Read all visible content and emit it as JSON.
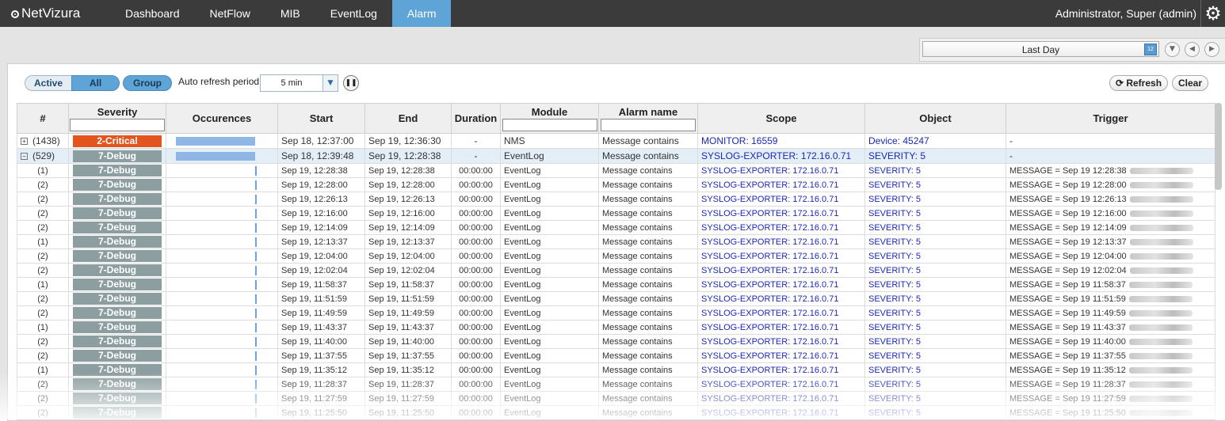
{
  "app": {
    "logo": "NetVizura",
    "user": "Administrator, Super (admin)"
  },
  "nav": [
    {
      "label": "Dashboard"
    },
    {
      "label": "NetFlow"
    },
    {
      "label": "MIB"
    },
    {
      "label": "EventLog"
    },
    {
      "label": "Alarm",
      "active": true
    }
  ],
  "period": {
    "value": "Last Day"
  },
  "toolbar": {
    "active_label": "Active",
    "all_label": "All",
    "group_label": "Group",
    "auto_refresh_label": "Auto refresh period:",
    "auto_refresh_value": "5 min",
    "refresh_label": "Refresh",
    "clear_label": "Clear"
  },
  "columns": [
    "#",
    "Severity",
    "Occurences",
    "Start",
    "End",
    "Duration",
    "Module",
    "Alarm name",
    "Scope",
    "Object",
    "Trigger"
  ],
  "groups": [
    {
      "count": "(1438)",
      "severity": "2-Critical",
      "severity_color": "#e2551f",
      "start": "Sep 18, 12:37:00",
      "end": "Sep 19, 12:36:30",
      "duration": "-",
      "module": "NMS",
      "alarm": "Message contains",
      "scope": "MONITOR: 16559",
      "object": "Device: 45247",
      "trigger": "-"
    },
    {
      "count": "(529)",
      "severity": "7-Debug",
      "severity_color": "#8d9ea0",
      "start": "Sep 18, 12:39:48",
      "end": "Sep 19, 12:28:38",
      "duration": "-",
      "module": "EventLog",
      "alarm": "Message contains",
      "scope": "SYSLOG-EXPORTER: 172.16.0.71",
      "object": "SEVERITY: 5",
      "trigger": "-"
    }
  ],
  "rows": [
    {
      "count": "(1)",
      "severity": "7-Debug",
      "start": "Sep 19, 12:28:38",
      "end": "Sep 19, 12:28:38",
      "duration": "00:00:00",
      "module": "EventLog",
      "alarm": "Message contains",
      "scope": "SYSLOG-EXPORTER: 172.16.0.71",
      "object": "SEVERITY: 5",
      "trigger": "MESSAGE = Sep 19 12:28:38"
    },
    {
      "count": "(2)",
      "severity": "7-Debug",
      "start": "Sep 19, 12:28:00",
      "end": "Sep 19, 12:28:00",
      "duration": "00:00:00",
      "module": "EventLog",
      "alarm": "Message contains",
      "scope": "SYSLOG-EXPORTER: 172.16.0.71",
      "object": "SEVERITY: 5",
      "trigger": "MESSAGE = Sep 19 12:28:00"
    },
    {
      "count": "(2)",
      "severity": "7-Debug",
      "start": "Sep 19, 12:26:13",
      "end": "Sep 19, 12:26:13",
      "duration": "00:00:00",
      "module": "EventLog",
      "alarm": "Message contains",
      "scope": "SYSLOG-EXPORTER: 172.16.0.71",
      "object": "SEVERITY: 5",
      "trigger": "MESSAGE = Sep 19 12:26:13"
    },
    {
      "count": "(2)",
      "severity": "7-Debug",
      "start": "Sep 19, 12:16:00",
      "end": "Sep 19, 12:16:00",
      "duration": "00:00:00",
      "module": "EventLog",
      "alarm": "Message contains",
      "scope": "SYSLOG-EXPORTER: 172.16.0.71",
      "object": "SEVERITY: 5",
      "trigger": "MESSAGE = Sep 19 12:16:00"
    },
    {
      "count": "(2)",
      "severity": "7-Debug",
      "start": "Sep 19, 12:14:09",
      "end": "Sep 19, 12:14:09",
      "duration": "00:00:00",
      "module": "EventLog",
      "alarm": "Message contains",
      "scope": "SYSLOG-EXPORTER: 172.16.0.71",
      "object": "SEVERITY: 5",
      "trigger": "MESSAGE = Sep 19 12:14:09"
    },
    {
      "count": "(1)",
      "severity": "7-Debug",
      "start": "Sep 19, 12:13:37",
      "end": "Sep 19, 12:13:37",
      "duration": "00:00:00",
      "module": "EventLog",
      "alarm": "Message contains",
      "scope": "SYSLOG-EXPORTER: 172.16.0.71",
      "object": "SEVERITY: 5",
      "trigger": "MESSAGE = Sep 19 12:13:37"
    },
    {
      "count": "(2)",
      "severity": "7-Debug",
      "start": "Sep 19, 12:04:00",
      "end": "Sep 19, 12:04:00",
      "duration": "00:00:00",
      "module": "EventLog",
      "alarm": "Message contains",
      "scope": "SYSLOG-EXPORTER: 172.16.0.71",
      "object": "SEVERITY: 5",
      "trigger": "MESSAGE = Sep 19 12:04:00"
    },
    {
      "count": "(2)",
      "severity": "7-Debug",
      "start": "Sep 19, 12:02:04",
      "end": "Sep 19, 12:02:04",
      "duration": "00:00:00",
      "module": "EventLog",
      "alarm": "Message contains",
      "scope": "SYSLOG-EXPORTER: 172.16.0.71",
      "object": "SEVERITY: 5",
      "trigger": "MESSAGE = Sep 19 12:02:04"
    },
    {
      "count": "(1)",
      "severity": "7-Debug",
      "start": "Sep 19, 11:58:37",
      "end": "Sep 19, 11:58:37",
      "duration": "00:00:00",
      "module": "EventLog",
      "alarm": "Message contains",
      "scope": "SYSLOG-EXPORTER: 172.16.0.71",
      "object": "SEVERITY: 5",
      "trigger": "MESSAGE = Sep 19 11:58:37"
    },
    {
      "count": "(2)",
      "severity": "7-Debug",
      "start": "Sep 19, 11:51:59",
      "end": "Sep 19, 11:51:59",
      "duration": "00:00:00",
      "module": "EventLog",
      "alarm": "Message contains",
      "scope": "SYSLOG-EXPORTER: 172.16.0.71",
      "object": "SEVERITY: 5",
      "trigger": "MESSAGE = Sep 19 11:51:59"
    },
    {
      "count": "(2)",
      "severity": "7-Debug",
      "start": "Sep 19, 11:49:59",
      "end": "Sep 19, 11:49:59",
      "duration": "00:00:00",
      "module": "EventLog",
      "alarm": "Message contains",
      "scope": "SYSLOG-EXPORTER: 172.16.0.71",
      "object": "SEVERITY: 5",
      "trigger": "MESSAGE = Sep 19 11:49:59"
    },
    {
      "count": "(1)",
      "severity": "7-Debug",
      "start": "Sep 19, 11:43:37",
      "end": "Sep 19, 11:43:37",
      "duration": "00:00:00",
      "module": "EventLog",
      "alarm": "Message contains",
      "scope": "SYSLOG-EXPORTER: 172.16.0.71",
      "object": "SEVERITY: 5",
      "trigger": "MESSAGE = Sep 19 11:43:37"
    },
    {
      "count": "(2)",
      "severity": "7-Debug",
      "start": "Sep 19, 11:40:00",
      "end": "Sep 19, 11:40:00",
      "duration": "00:00:00",
      "module": "EventLog",
      "alarm": "Message contains",
      "scope": "SYSLOG-EXPORTER: 172.16.0.71",
      "object": "SEVERITY: 5",
      "trigger": "MESSAGE = Sep 19 11:40:00"
    },
    {
      "count": "(2)",
      "severity": "7-Debug",
      "start": "Sep 19, 11:37:55",
      "end": "Sep 19, 11:37:55",
      "duration": "00:00:00",
      "module": "EventLog",
      "alarm": "Message contains",
      "scope": "SYSLOG-EXPORTER: 172.16.0.71",
      "object": "SEVERITY: 5",
      "trigger": "MESSAGE = Sep 19 11:37:55"
    },
    {
      "count": "(1)",
      "severity": "7-Debug",
      "start": "Sep 19, 11:35:12",
      "end": "Sep 19, 11:35:12",
      "duration": "00:00:00",
      "module": "EventLog",
      "alarm": "Message contains",
      "scope": "SYSLOG-EXPORTER: 172.16.0.71",
      "object": "SEVERITY: 5",
      "trigger": "MESSAGE = Sep 19 11:35:12"
    },
    {
      "count": "(2)",
      "severity": "7-Debug",
      "start": "Sep 19, 11:28:37",
      "end": "Sep 19, 11:28:37",
      "duration": "00:00:00",
      "module": "EventLog",
      "alarm": "Message contains",
      "scope": "SYSLOG-EXPORTER: 172.16.0.71",
      "object": "SEVERITY: 5",
      "trigger": "MESSAGE = Sep 19 11:28:37"
    },
    {
      "count": "(2)",
      "severity": "7-Debug",
      "start": "Sep 19, 11:27:59",
      "end": "Sep 19, 11:27:59",
      "duration": "00:00:00",
      "module": "EventLog",
      "alarm": "Message contains",
      "scope": "SYSLOG-EXPORTER: 172.16.0.71",
      "object": "SEVERITY: 5",
      "trigger": "MESSAGE = Sep 19 11:27:59"
    },
    {
      "count": "(2)",
      "severity": "7-Debug",
      "start": "Sep 19, 11:25:50",
      "end": "Sep 19, 11:25:50",
      "duration": "00:00:00",
      "module": "EventLog",
      "alarm": "Message contains",
      "scope": "SYSLOG-EXPORTER: 172.16.0.71",
      "object": "SEVERITY: 5",
      "trigger": "MESSAGE = Sep 19 11:25:50"
    }
  ]
}
